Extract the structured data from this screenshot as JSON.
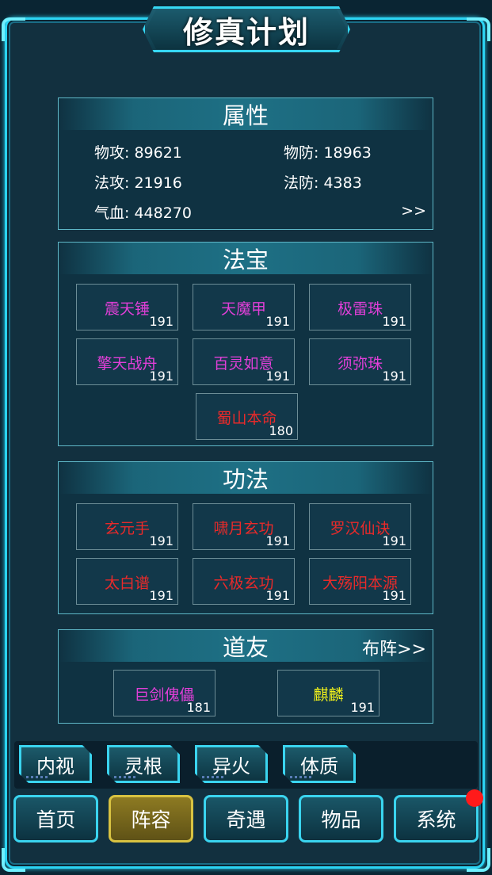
{
  "title": "修真计划",
  "colors": {
    "accent": "#2bd3f2",
    "magenta": "#e13fd8",
    "red": "#e82a2a",
    "yellow": "#f3f31a"
  },
  "attributes": {
    "heading": "属性",
    "phys_atk": "物攻: 89621",
    "phys_def": "物防: 18963",
    "magic_atk": "法攻: 21916",
    "magic_def": "法防: 4383",
    "hp": "气血: 448270",
    "more": ">>"
  },
  "treasures": {
    "heading": "法宝",
    "items": [
      {
        "name": "震天锤",
        "level": "191",
        "color": "#e13fd8"
      },
      {
        "name": "天魔甲",
        "level": "191",
        "color": "#e13fd8"
      },
      {
        "name": "极雷珠",
        "level": "191",
        "color": "#e13fd8"
      },
      {
        "name": "擎天战舟",
        "level": "191",
        "color": "#e13fd8"
      },
      {
        "name": "百灵如意",
        "level": "191",
        "color": "#e13fd8"
      },
      {
        "name": "须弥珠",
        "level": "191",
        "color": "#e13fd8"
      },
      {
        "name": "蜀山本命",
        "level": "180",
        "color": "#e82a2a"
      }
    ]
  },
  "skills": {
    "heading": "功法",
    "items": [
      {
        "name": "玄元手",
        "level": "191",
        "color": "#e82a2a"
      },
      {
        "name": "啸月玄功",
        "level": "191",
        "color": "#e82a2a"
      },
      {
        "name": "罗汉仙诀",
        "level": "191",
        "color": "#e82a2a"
      },
      {
        "name": "太白谱",
        "level": "191",
        "color": "#e82a2a"
      },
      {
        "name": "六极玄功",
        "level": "191",
        "color": "#e82a2a"
      },
      {
        "name": "大殇阳本源",
        "level": "191",
        "color": "#e82a2a"
      }
    ]
  },
  "companions": {
    "heading": "道友",
    "formation_link": "布阵>>",
    "items": [
      {
        "name": "巨剑傀儡",
        "level": "181",
        "color": "#e13fd8"
      },
      {
        "name": "麒麟",
        "level": "191",
        "color": "#f3f31a"
      }
    ]
  },
  "sub_tabs": [
    "内视",
    "灵根",
    "异火",
    "体质"
  ],
  "nav": {
    "items": [
      "首页",
      "阵容",
      "奇遇",
      "物品",
      "系统"
    ],
    "active": "阵容"
  }
}
